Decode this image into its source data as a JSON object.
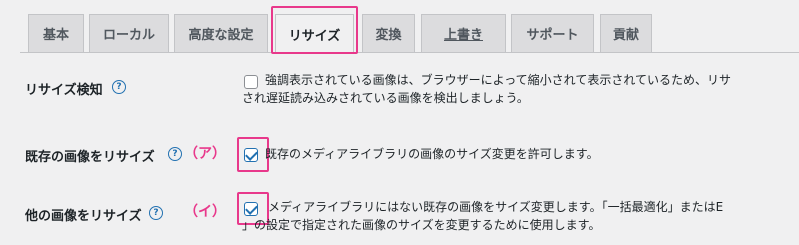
{
  "tabs": [
    {
      "label": "基本"
    },
    {
      "label": "ローカル"
    },
    {
      "label": "高度な設定"
    },
    {
      "label": "リサイズ"
    },
    {
      "label": "変換"
    },
    {
      "label": "上書き"
    },
    {
      "label": "サポート"
    },
    {
      "label": "貢献"
    }
  ],
  "active_tab": "リサイズ",
  "settings": [
    {
      "label": "リサイズ検知",
      "help_icon": "?",
      "checked": false,
      "description_line1": "強調表示されている画像は、ブラウザーによって縮小されて表示されているため、リサ",
      "description_line2": "され遅延読み込みされている画像を検出しましょう。"
    },
    {
      "label": "既存の画像をリサイズ",
      "help_icon": "?",
      "marker": "（ア）",
      "checked": true,
      "description_line1": "既存のメディアライブラリの画像のサイズ変更を許可します。"
    },
    {
      "label": "他の画像をリサイズ",
      "help_icon": "?",
      "marker": "（イ）",
      "checked": true,
      "description_line1": "メディアライブラリにはない既存の画像をサイズ変更します。「一括最適化」またはE",
      "description_line2": "」の設定で指定された画像のサイズを変更するために使用します。"
    }
  ],
  "colors": {
    "highlight": "#e8388b",
    "accent": "#2271b1",
    "background": "#f0f0f1",
    "tab_inactive": "#dcdcde"
  }
}
